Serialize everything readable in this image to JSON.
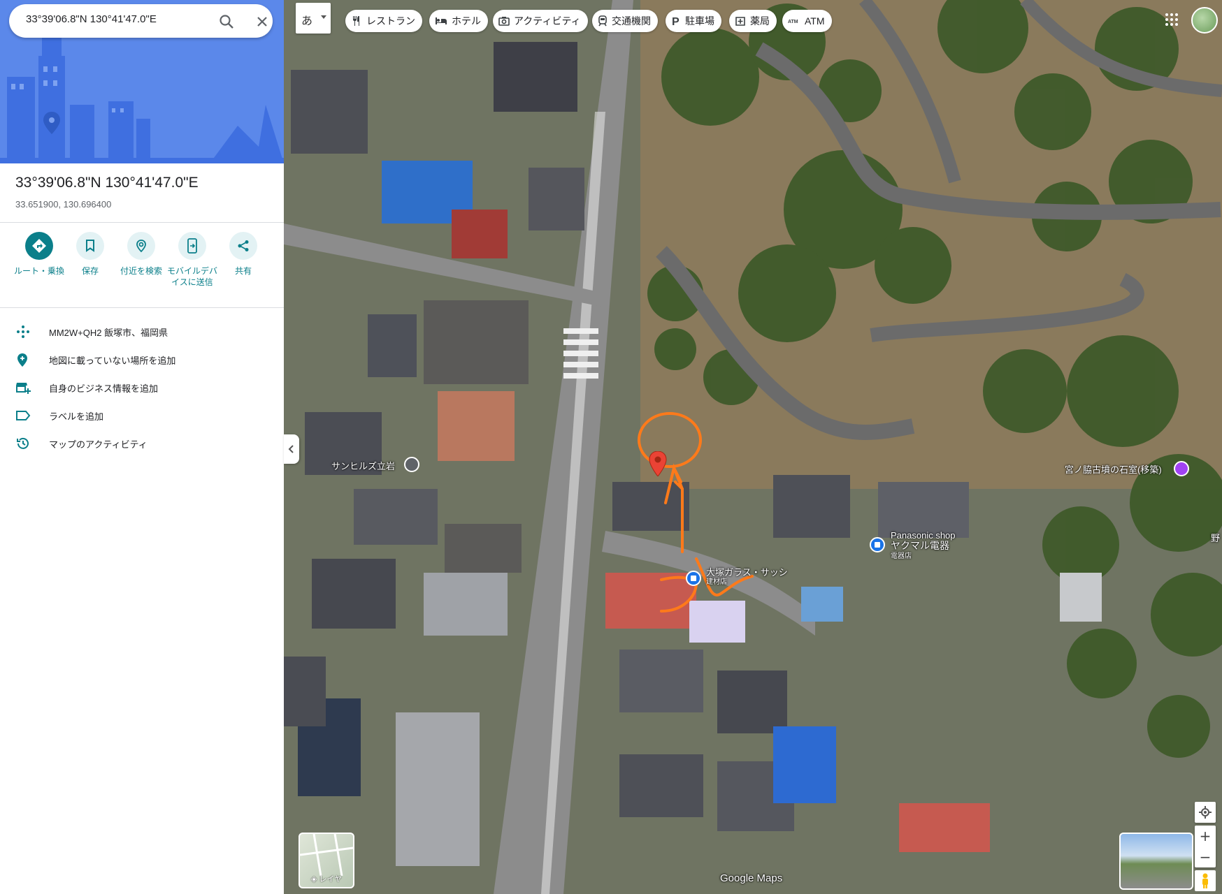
{
  "search": {
    "value": "33°39'06.8\"N 130°41'47.0\"E"
  },
  "place": {
    "title": "33°39'06.8\"N 130°41'47.0\"E",
    "decimal": "33.651900, 130.696400"
  },
  "actions": [
    {
      "label": "ルート・乗換",
      "icon": "directions-icon"
    },
    {
      "label": "保存",
      "icon": "bookmark-icon"
    },
    {
      "label": "付近を検索",
      "icon": "nearby-search-icon"
    },
    {
      "label": "モバイルデバイスに送信",
      "icon": "send-to-phone-icon"
    },
    {
      "label": "共有",
      "icon": "share-icon"
    }
  ],
  "info": [
    {
      "text": "MM2W+QH2 飯塚市、福岡県",
      "icon": "plus-code-icon"
    },
    {
      "text": "地図に載っていない場所を追加",
      "icon": "add-place-icon"
    },
    {
      "text": "自身のビジネス情報を追加",
      "icon": "add-business-icon"
    },
    {
      "text": "ラベルを追加",
      "icon": "label-icon"
    },
    {
      "text": "マップのアクティビティ",
      "icon": "history-icon"
    }
  ],
  "ime": {
    "label": "あ"
  },
  "chips": [
    {
      "label": "レストラン",
      "icon": "restaurant-icon"
    },
    {
      "label": "ホテル",
      "icon": "hotel-icon"
    },
    {
      "label": "アクティビティ",
      "icon": "camera-icon"
    },
    {
      "label": "交通機関",
      "icon": "train-icon"
    },
    {
      "label": "駐車場",
      "icon": "parking-icon"
    },
    {
      "label": "薬局",
      "icon": "pharmacy-icon"
    },
    {
      "label": "ATM",
      "icon": "atm-icon"
    }
  ],
  "map_labels": {
    "sunhills": "サンヒルズ立岩",
    "kofun": "宮ノ脇古墳の石室(移築)",
    "panasonic_1": "Panasonic shop",
    "panasonic_2": "ヤクマル電器",
    "panasonic_3": "電器店",
    "otsuka_1": "大塚ガラス・サッシ",
    "otsuka_2": "建材店",
    "edge": "野"
  },
  "layers": {
    "label": "レイヤ"
  },
  "attribution": "Google Maps",
  "colors": {
    "accent": "#0b7f8a",
    "pin": "#ea4335",
    "annotation": "#ff7a1a"
  }
}
